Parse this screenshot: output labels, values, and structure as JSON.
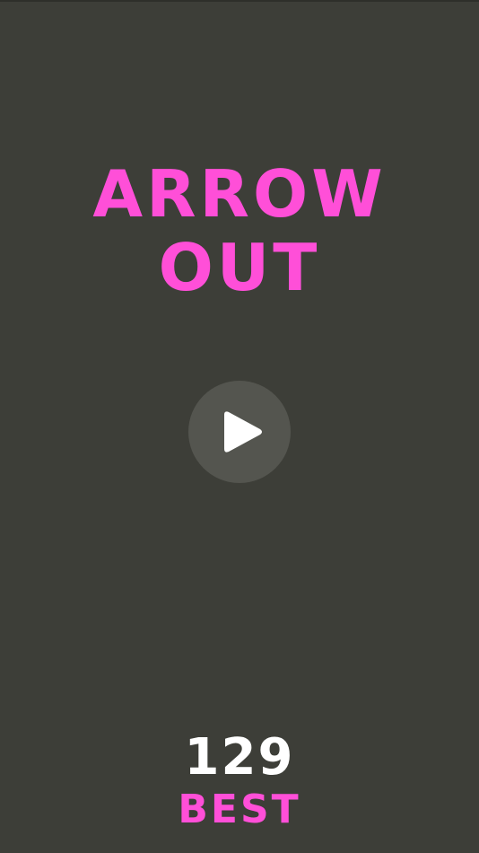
{
  "title": {
    "line1": "ARROW",
    "line2": "OUT"
  },
  "play_button": {
    "icon": "play-icon"
  },
  "best": {
    "score": "129",
    "label": "BEST"
  },
  "colors": {
    "background": "#3d3e38",
    "accent": "#ff4fd8",
    "button": "#54554f",
    "score_text": "#ffffff"
  }
}
